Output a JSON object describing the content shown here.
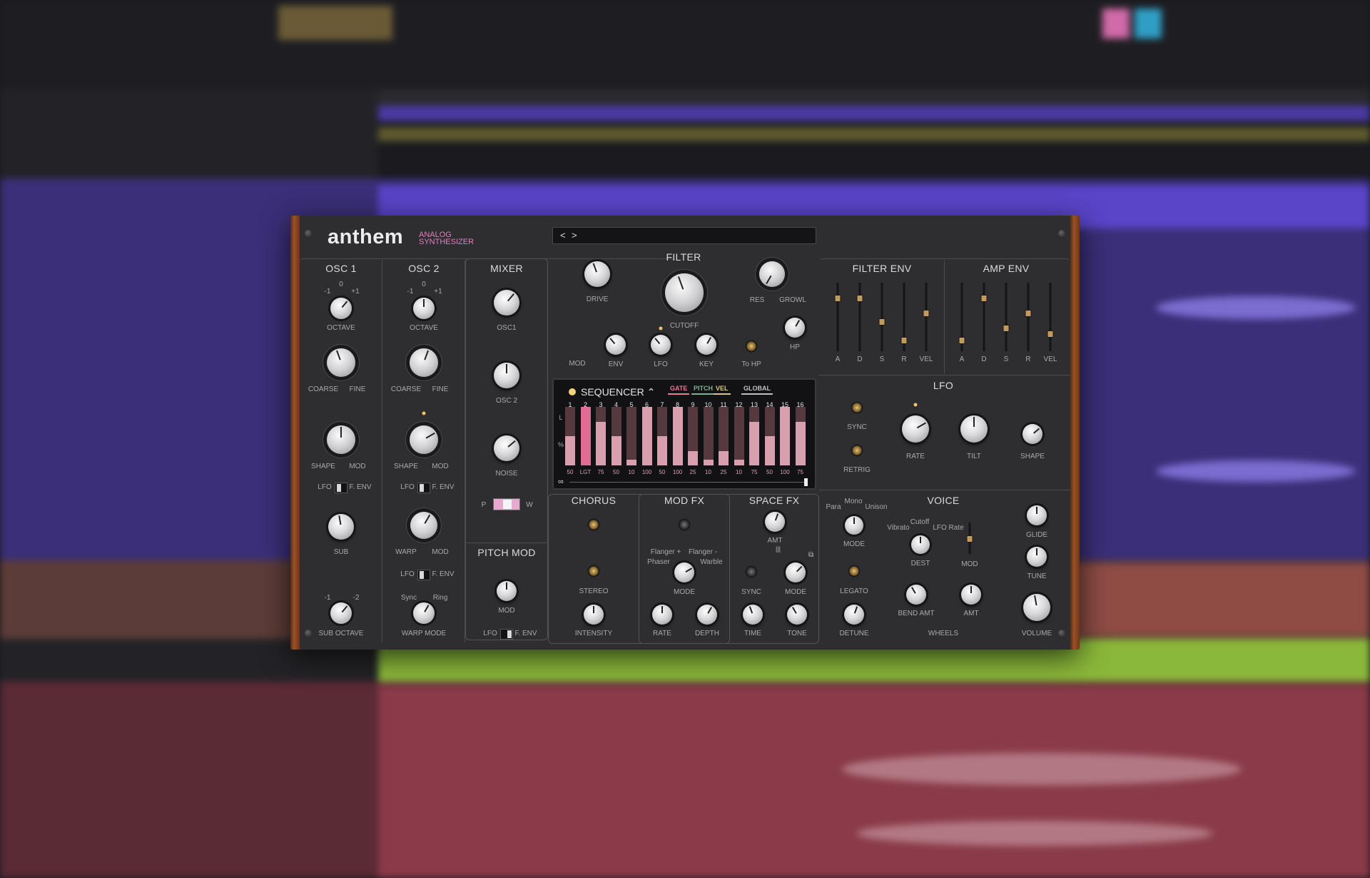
{
  "brand": {
    "logo": "anthem",
    "subtitle_line1": "ANALOG",
    "subtitle_line2": "SYNTHESIZER"
  },
  "preset": {
    "prev": "<",
    "next": ">",
    "name": ""
  },
  "osc1": {
    "title": "OSC 1",
    "oct_m1": "-1",
    "oct_0": "0",
    "oct_p1": "+1",
    "octave": "OCTAVE",
    "coarse": "COARSE",
    "fine": "FINE",
    "shape": "SHAPE",
    "mod": "MOD",
    "lfo": "LFO",
    "fenv": "F. ENV",
    "sub": "SUB",
    "sub_m1": "-1",
    "sub_m2": "-2",
    "sub_octave": "SUB OCTAVE"
  },
  "osc2": {
    "title": "OSC 2",
    "oct_m1": "-1",
    "oct_0": "0",
    "oct_p1": "+1",
    "octave": "OCTAVE",
    "coarse": "COARSE",
    "fine": "FINE",
    "shape": "SHAPE",
    "mod": "MOD",
    "lfo": "LFO",
    "fenv": "F. ENV",
    "warp": "WARP",
    "warp_mod": "MOD",
    "lfo2": "LFO",
    "fenv2": "F. ENV",
    "sync": "Sync",
    "ring": "Ring",
    "warp_mode": "WARP MODE"
  },
  "mixer": {
    "title": "MIXER",
    "osc1": "OSC1",
    "osc2": "OSC 2",
    "noise": "NOISE",
    "p": "P",
    "w": "W"
  },
  "pitchmod": {
    "title": "PITCH MOD",
    "mod": "MOD",
    "lfo": "LFO",
    "fenv": "F. ENV"
  },
  "filter": {
    "title": "FILTER",
    "drive": "DRIVE",
    "cutoff": "CUTOFF",
    "res": "RES",
    "growl": "GROWL",
    "mod": "MOD",
    "env": "ENV",
    "lfo": "LFO",
    "key": "KEY",
    "tohp": "To HP",
    "hp": "HP"
  },
  "filter_env": {
    "title": "FILTER ENV",
    "labels": [
      "A",
      "D",
      "S",
      "R",
      "VEL"
    ],
    "levels": [
      0.8,
      0.8,
      0.4,
      0.1,
      0.55
    ]
  },
  "amp_env": {
    "title": "AMP ENV",
    "labels": [
      "A",
      "D",
      "S",
      "R",
      "VEL"
    ],
    "levels": [
      0.1,
      0.8,
      0.3,
      0.55,
      0.2
    ]
  },
  "lfo": {
    "title": "LFO",
    "sync": "SYNC",
    "retrig": "RETRIG",
    "rate": "RATE",
    "tilt": "TILT",
    "shape": "SHAPE"
  },
  "sequencer": {
    "title": "SEQUENCER",
    "tabs": [
      "GATE",
      "PITCH",
      "VEL",
      "GLOBAL"
    ],
    "tab_colors": [
      "#e07f97",
      "#7fb28f",
      "#d9c97c",
      "#c0c0c4"
    ],
    "steps": [
      "1",
      "2",
      "3",
      "4",
      "5",
      "6",
      "7",
      "8",
      "9",
      "10",
      "11",
      "12",
      "13",
      "14",
      "15",
      "16"
    ],
    "values": [
      "50",
      "LGT",
      "75",
      "50",
      "10",
      "100",
      "50",
      "100",
      "25",
      "10",
      "25",
      "10",
      "75",
      "50",
      "100",
      "75"
    ],
    "levels": [
      0.5,
      1,
      0.75,
      0.5,
      0.1,
      1,
      0.5,
      1,
      0.25,
      0.1,
      0.25,
      0.1,
      0.75,
      0.5,
      1,
      0.75
    ],
    "l_label": "L",
    "pct_label": "%"
  },
  "chorus": {
    "title": "CHORUS",
    "stereo": "STEREO",
    "intensity": "INTENSITY"
  },
  "modfx": {
    "title": "MOD FX",
    "opt1a": "Flanger +",
    "opt1b": "Phaser",
    "opt2a": "Flanger -",
    "opt2b": "Warble",
    "mode": "MODE",
    "rate": "RATE",
    "depth": "DEPTH"
  },
  "spacefx": {
    "title": "SPACE FX",
    "amt": "AMT",
    "sync": "SYNC",
    "mode": "MODE",
    "time": "TIME",
    "tone": "TONE"
  },
  "voice": {
    "title": "VOICE",
    "para": "Para",
    "mono": "Mono",
    "unison": "Unison",
    "mode": "MODE",
    "legato": "LEGATO",
    "detune": "DETUNE",
    "vibrato": "Vibrato",
    "cutoff": "Cutoff",
    "lfo_rate": "LFO Rate",
    "dest": "DEST",
    "mod": "MOD",
    "bend_amt": "BEND AMT",
    "amt": "AMT",
    "wheels": "WHEELS",
    "glide": "GLIDE",
    "tune": "TUNE",
    "volume": "VOLUME"
  }
}
